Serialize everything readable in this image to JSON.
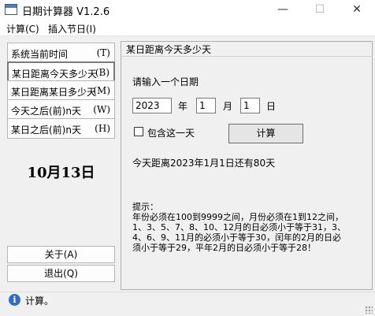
{
  "window": {
    "title": "日期计算器 V1.2.6",
    "controls": {
      "minimize": "—",
      "maximize": "☐",
      "close": "✕"
    }
  },
  "menu": {
    "items": [
      "计算(C)",
      "插入节日(I)"
    ]
  },
  "sidebar": {
    "nav": [
      {
        "label": "系统当前时间",
        "key": "(T)"
      },
      {
        "label": "某日距离今天多少天",
        "key": "(B)"
      },
      {
        "label": "某日距离某日多少天",
        "key": "(M)"
      },
      {
        "label": "今天之后(前)n天",
        "key": "(W)"
      },
      {
        "label": "某日之后(前)n天",
        "key": "(H)"
      }
    ],
    "today": "10月13日",
    "about": "关于(A)",
    "exit": "退出(Q)"
  },
  "panel": {
    "title": "某日距离今天多少天",
    "prompt": "请输入一个日期",
    "year_value": "2023",
    "year_unit": "年",
    "month_value": "1",
    "month_unit": "月",
    "day_value": "1",
    "day_unit": "日",
    "include_label": "包含这一天",
    "calc_button": "计算",
    "result": "今天距离2023年1月1日还有80天",
    "hint_lines": [
      "提示：",
      "年份必须在100到9999之间，月份必须在1到12之间，",
      "1、3、5、7、8、10、12月的日必须小于等于31，3、",
      "4、6、9、11月的必须小于等于30，闰年的2月的日必",
      "须小于等于29，平年2月的日必须小于等于28！"
    ]
  },
  "status": {
    "text": "计算。"
  }
}
